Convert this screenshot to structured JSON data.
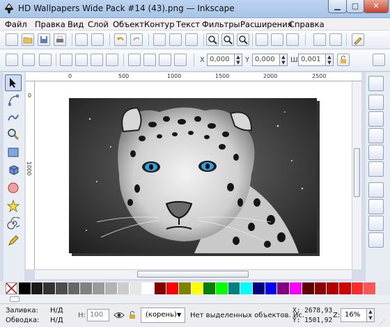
{
  "window": {
    "title": "HD Wallpapers Wide Pack #14 (43).png — Inkscape",
    "min_icon": "minimize-icon",
    "max_icon": "maximize-icon",
    "close_label": "✕"
  },
  "menu": [
    "Файл",
    "Правка",
    "Вид",
    "Слой",
    "Объект",
    "Контур",
    "Текст",
    "Фильтры",
    "Расширения",
    "Справка"
  ],
  "toolbar2": {
    "x_label": "X",
    "x_value": "0,000",
    "y_label": "Y",
    "y_value": "0,000",
    "w_label": "Ш",
    "w_value": "0,001"
  },
  "ruler": {
    "top_ticks": [
      "0",
      "500",
      "1000",
      "1500",
      "2000",
      "2500"
    ],
    "left_ticks": [
      "0",
      "1000"
    ]
  },
  "tools_left": [
    "selector-tool-icon",
    "node-tool-icon",
    "tweak-tool-icon",
    "zoom-tool-icon",
    "rect-tool-icon",
    "box3d-tool-icon",
    "ellipse-tool-icon",
    "star-tool-icon",
    "spiral-tool-icon",
    "pencil-tool-icon"
  ],
  "palette_colors": [
    "#000000",
    "#1a1a1a",
    "#333333",
    "#4d4d4d",
    "#666666",
    "#808080",
    "#999999",
    "#b3b3b3",
    "#cccccc",
    "#e6e6e6",
    "#ffffff",
    "#800000",
    "#ff0000",
    "#808000",
    "#ffff00",
    "#008000",
    "#00ff00",
    "#008080",
    "#00ffff",
    "#000080",
    "#0000ff",
    "#800080",
    "#ff00ff",
    "#5e0000",
    "#8b0000",
    "#b00000",
    "#d40000",
    "#ff2a2a",
    "#ff5555"
  ],
  "status": {
    "fill_label": "Заливка:",
    "fill_value": "Н/Д",
    "stroke_label": "Обводка:",
    "stroke_value": "Н/Д",
    "opacity_label": "Н:",
    "opacity_value": "100",
    "layer_value": "(корень)",
    "message": "Нет выделенных объектов. Ис.",
    "x_coord": "X: 2678,93",
    "y_coord": "Y: 1501,92",
    "zoom_label": "Z:",
    "zoom_value": "16%"
  }
}
